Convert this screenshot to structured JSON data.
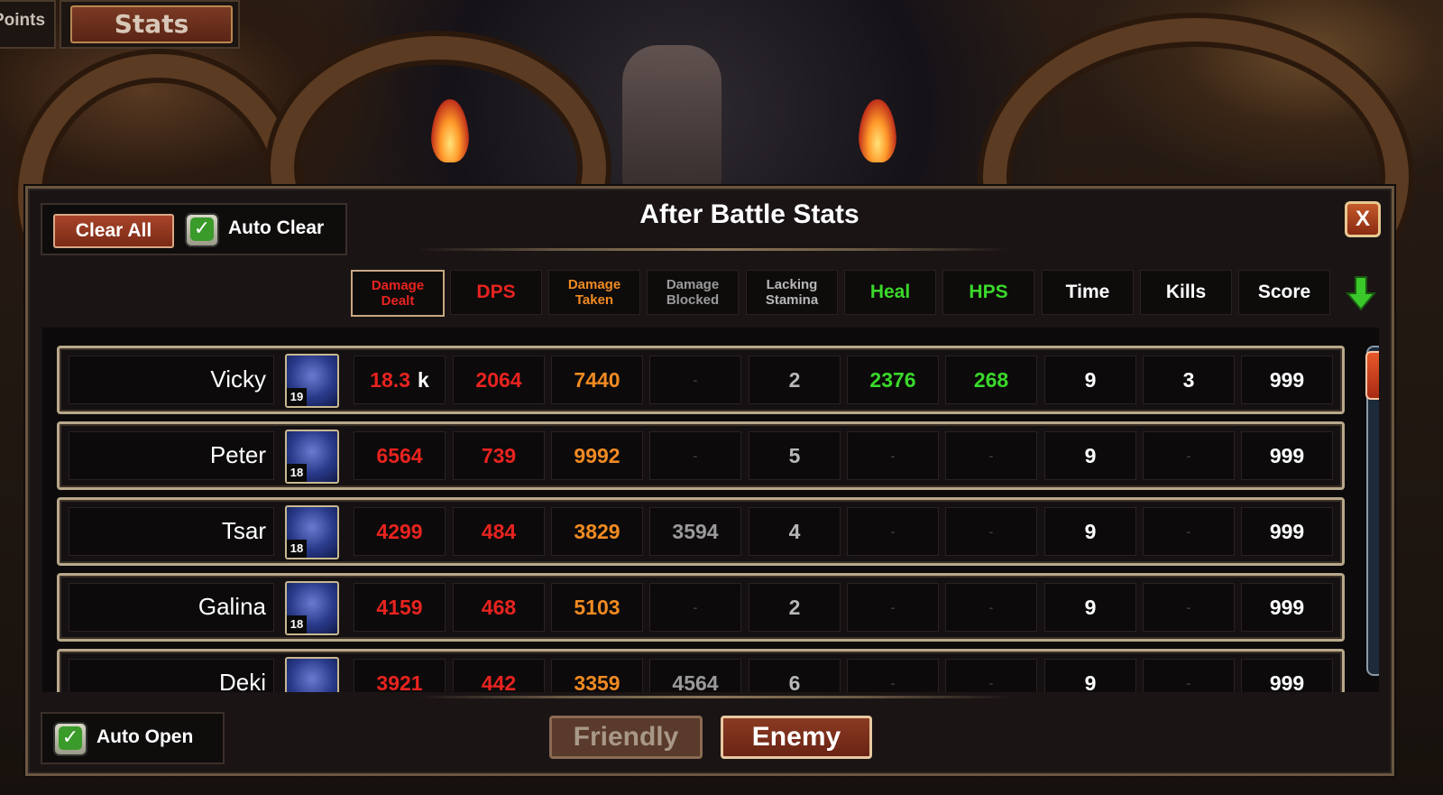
{
  "top_tabs": {
    "points_label": "Points",
    "stats_label": "Stats"
  },
  "panel": {
    "title": "After Battle Stats",
    "close_label": "X",
    "clear_all_label": "Clear All",
    "auto_clear_label": "Auto Clear",
    "auto_open_label": "Auto Open"
  },
  "columns": [
    {
      "label_line1": "Damage",
      "label_line2": "Dealt",
      "color": "#e8231f",
      "active": true
    },
    {
      "label_line1": "DPS",
      "label_line2": "",
      "color": "#e8231f",
      "active": false
    },
    {
      "label_line1": "Damage",
      "label_line2": "Taken",
      "color": "#f08a22",
      "active": false
    },
    {
      "label_line1": "Damage",
      "label_line2": "Blocked",
      "color": "#9a9a9a",
      "active": false
    },
    {
      "label_line1": "Lacking",
      "label_line2": "Stamina",
      "color": "#b8b8b8",
      "active": false
    },
    {
      "label_line1": "Heal",
      "label_line2": "",
      "color": "#3ad82a",
      "active": false
    },
    {
      "label_line1": "HPS",
      "label_line2": "",
      "color": "#3ad82a",
      "active": false
    },
    {
      "label_line1": "Time",
      "label_line2": "",
      "color": "#ffffff",
      "active": false
    },
    {
      "label_line1": "Kills",
      "label_line2": "",
      "color": "#ffffff",
      "active": false
    },
    {
      "label_line1": "Score",
      "label_line2": "",
      "color": "#ffffff",
      "active": false
    }
  ],
  "value_colors": [
    "#e8231f",
    "#e8231f",
    "#f08a22",
    "#9a9a9a",
    "#b8b8b8",
    "#3ad82a",
    "#3ad82a",
    "#ffffff",
    "#ffffff",
    "#ffffff"
  ],
  "rows": [
    {
      "name": "Vicky",
      "level": "19",
      "portrait_icon": "mage-portrait-icon",
      "dealt_value": "18.3",
      "dealt_suffix": "k",
      "values": [
        "2064",
        "7440",
        "-",
        "2",
        "2376",
        "268",
        "9",
        "3",
        "999"
      ]
    },
    {
      "name": "Peter",
      "level": "18",
      "portrait_icon": "goblin-warrior-portrait-icon",
      "dealt_value": "6564",
      "dealt_suffix": "",
      "values": [
        "739",
        "9992",
        "-",
        "5",
        "-",
        "-",
        "9",
        "-",
        "999"
      ]
    },
    {
      "name": "Tsar",
      "level": "18",
      "portrait_icon": "wolf-portrait-icon",
      "dealt_value": "4299",
      "dealt_suffix": "",
      "values": [
        "484",
        "3829",
        "3594",
        "4",
        "-",
        "-",
        "9",
        "-",
        "999"
      ]
    },
    {
      "name": "Galina",
      "level": "18",
      "portrait_icon": "elf-portrait-icon",
      "dealt_value": "4159",
      "dealt_suffix": "",
      "values": [
        "468",
        "5103",
        "-",
        "2",
        "-",
        "-",
        "9",
        "-",
        "999"
      ]
    },
    {
      "name": "Deki",
      "level": "",
      "portrait_icon": "goblin-portrait-icon",
      "dealt_value": "3921",
      "dealt_suffix": "",
      "values": [
        "442",
        "3359",
        "4564",
        "6",
        "-",
        "-",
        "9",
        "-",
        "999"
      ]
    }
  ],
  "team_tabs": {
    "friendly_label": "Friendly",
    "enemy_label": "Enemy",
    "selected": "Enemy"
  }
}
